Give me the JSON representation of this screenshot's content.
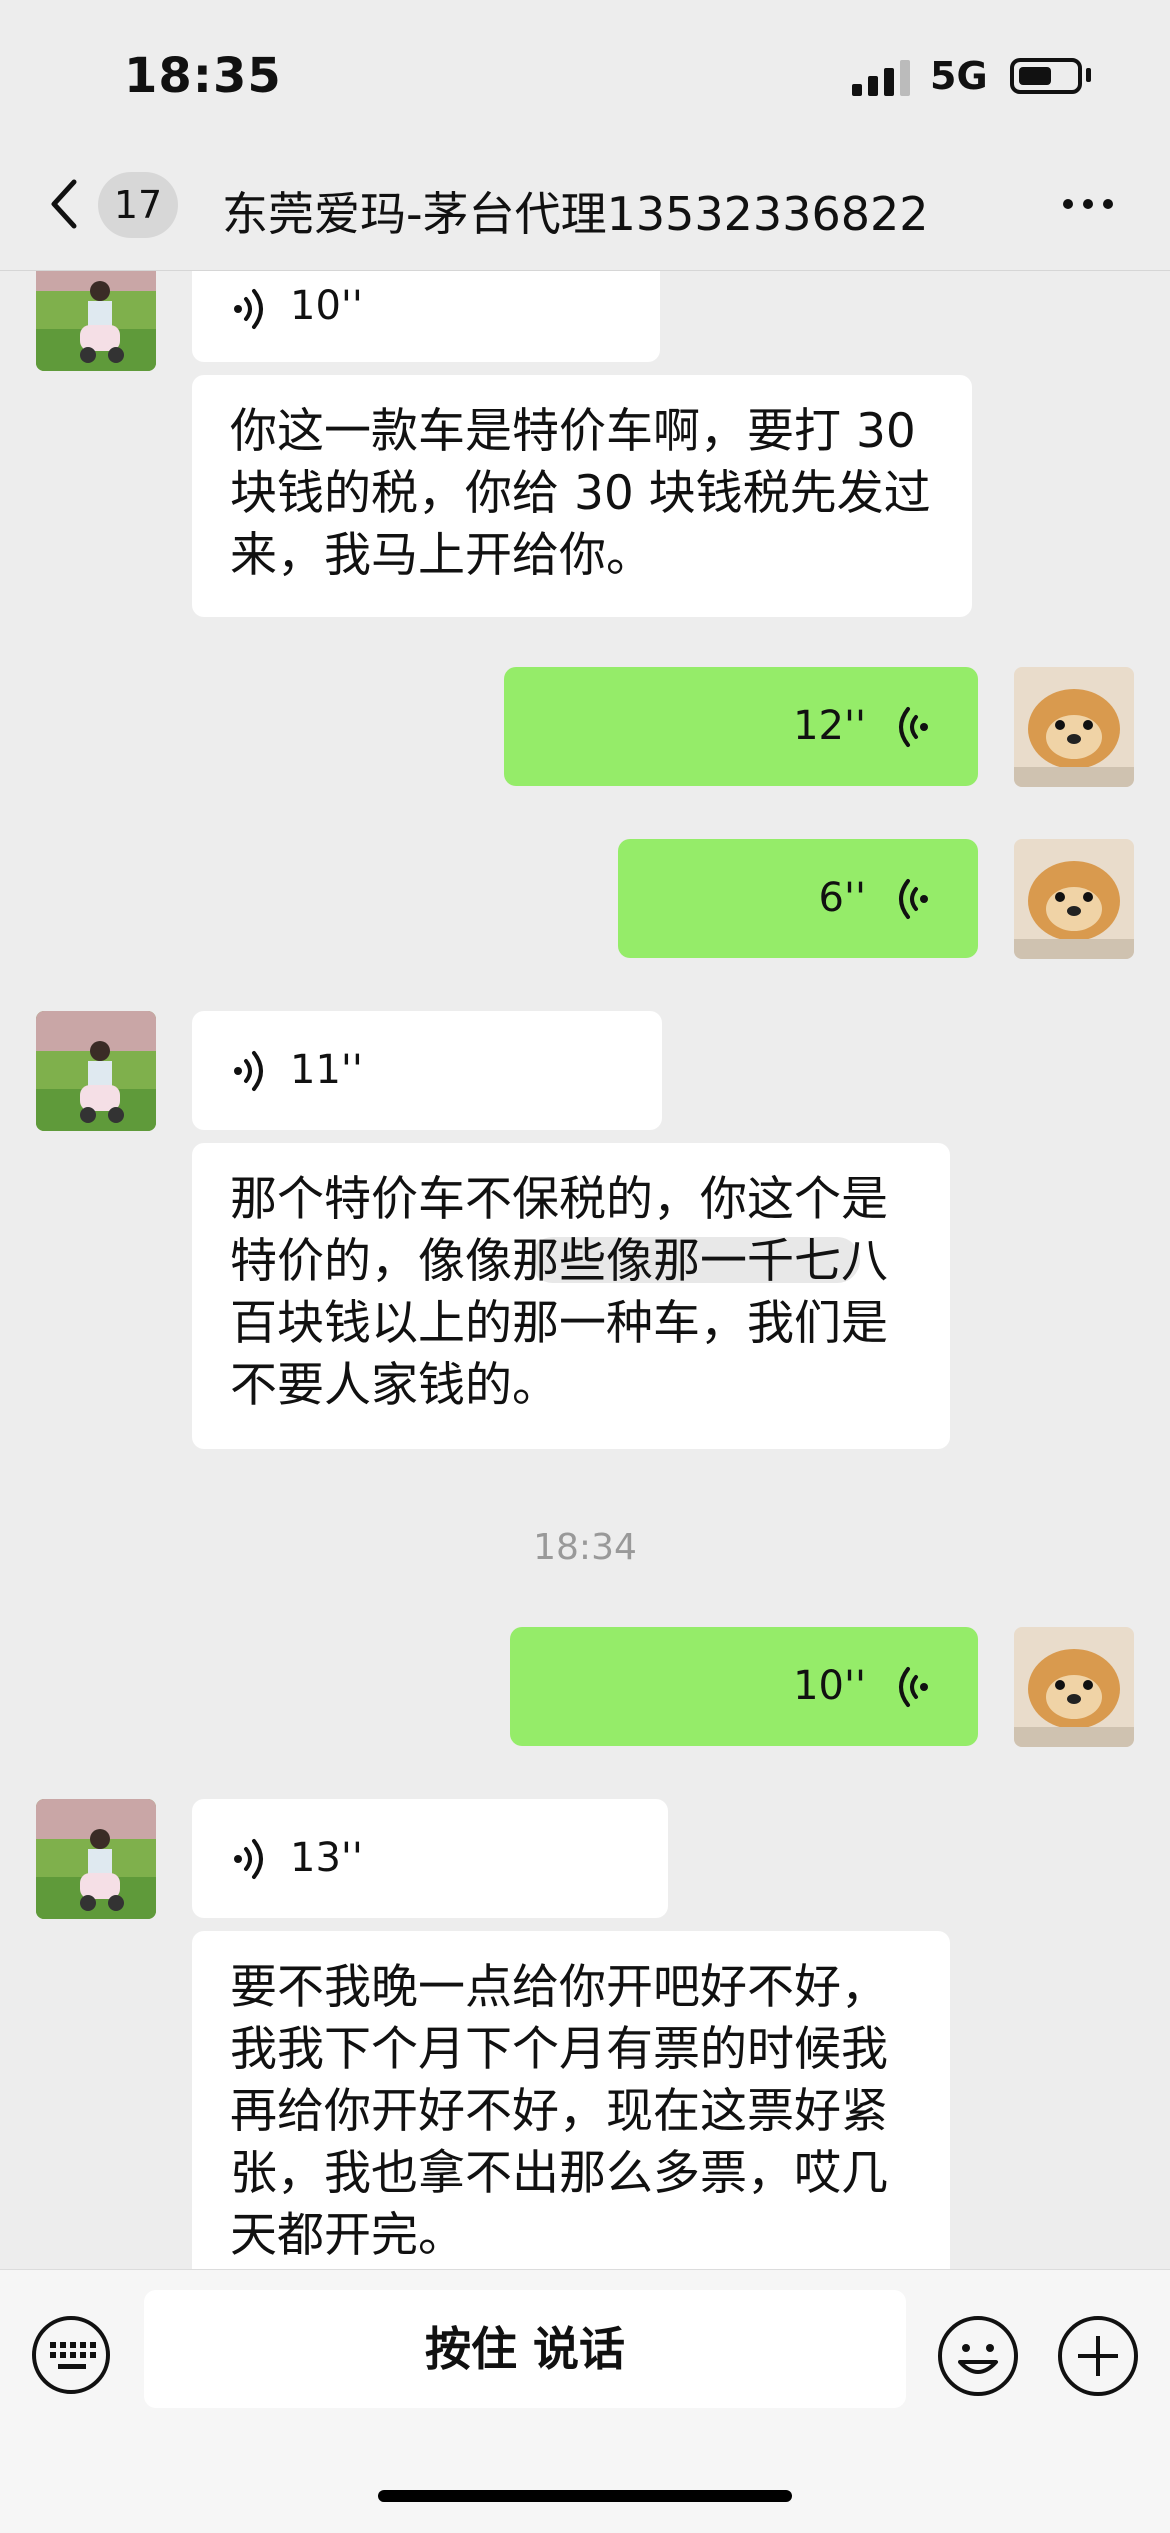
{
  "status_bar": {
    "time": "18:35",
    "network": "5G"
  },
  "nav": {
    "unread_count": "17",
    "title": "东莞爱玛-茅台代理13532336822"
  },
  "messages": [
    {
      "side": "left",
      "type": "voice",
      "duration": "10''"
    },
    {
      "side": "left",
      "type": "text",
      "lines": [
        "你这一款车是特价车啊，要打 30",
        "块钱的税，你给 30 块钱税先发过",
        "来，我马上开给你。"
      ]
    },
    {
      "side": "right",
      "type": "voice",
      "duration": "12''"
    },
    {
      "side": "right",
      "type": "voice",
      "duration": "6''"
    },
    {
      "side": "left",
      "type": "voice",
      "duration": "11''"
    },
    {
      "side": "left",
      "type": "text",
      "lines": [
        "那个特价车不保税的，你这个是",
        "特价的，像像那些像那一千七八",
        "百块钱以上的那一种车，我们是",
        "不要人家钱的。"
      ]
    },
    {
      "type": "timestamp",
      "text": "18:34"
    },
    {
      "side": "right",
      "type": "voice",
      "duration": "10''"
    },
    {
      "side": "left",
      "type": "voice",
      "duration": "13''"
    },
    {
      "side": "left",
      "type": "text",
      "lines": [
        "要不我晚一点给你开吧好不好，",
        "我我下个月下个月有票的时候我",
        "再给你开好不好，现在这票好紧",
        "张，我也拿不出那么多票，哎几",
        "天都开完。"
      ]
    }
  ],
  "input_bar": {
    "hold_to_talk": "按住 说话"
  },
  "colors": {
    "background": "#ededed",
    "sent_bubble": "#95ec69",
    "received_bubble": "#ffffff",
    "timestamp": "#999999"
  },
  "icons": [
    "chevron-left-icon",
    "more-dots-icon",
    "voice-wave-icon",
    "keyboard-icon",
    "emoji-icon",
    "plus-circle-icon",
    "cellular-signal-icon",
    "battery-icon"
  ]
}
